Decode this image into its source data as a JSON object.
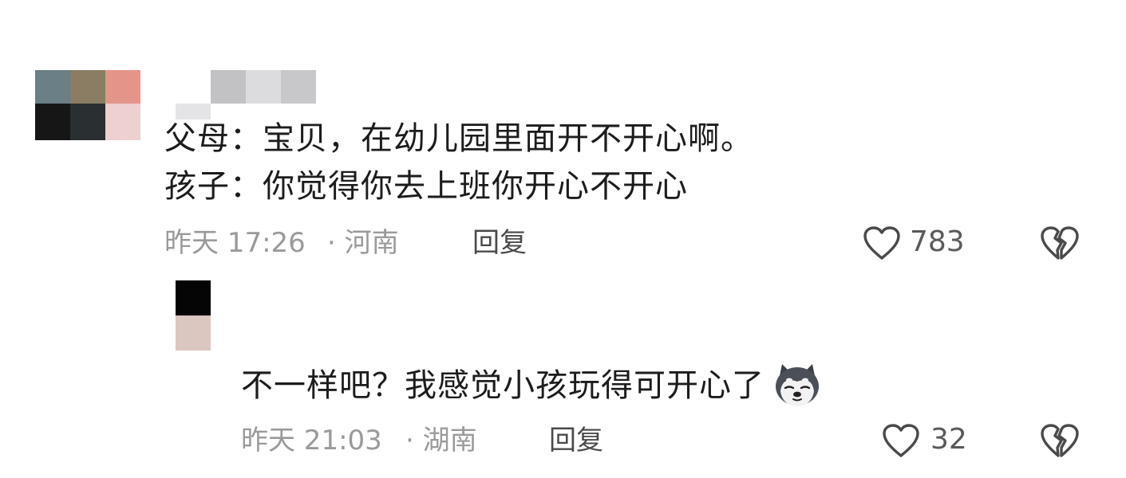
{
  "comments": [
    {
      "line1": "父母：宝贝，在幼儿园里面开不开心啊。",
      "line2": "孩子：你觉得你去上班你开心不开心",
      "time": "昨天 17:26",
      "location": "· 河南",
      "reply_label": "回复",
      "likes": "783"
    },
    {
      "text": "不一样吧？我感觉小孩玩得可开心了",
      "emoji": "husky-dog-emoji",
      "time": "昨天 21:03",
      "location": "· 湖南",
      "reply_label": "回复",
      "likes": "32"
    }
  ],
  "icons": {
    "like": "heart-outline-icon",
    "dislike": "broken-heart-icon"
  }
}
